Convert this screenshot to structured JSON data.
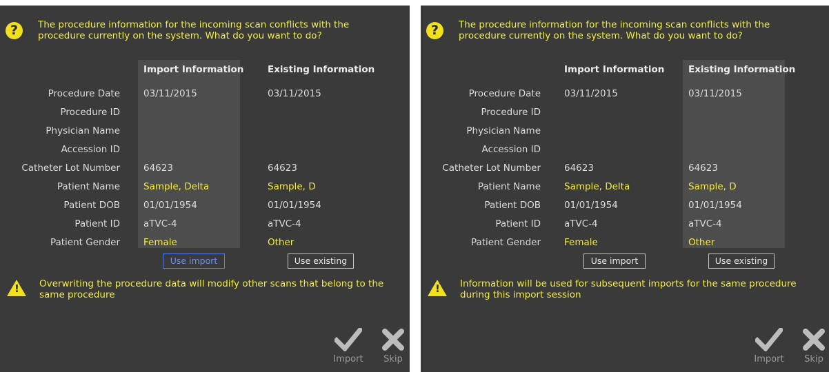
{
  "panels": [
    {
      "question": "The procedure information for the incoming scan conflicts with the procedure currently on the system.  What do you want to do?",
      "import_header": "Import Information",
      "existing_header": "Existing Information",
      "labels": [
        "Procedure Date",
        "Procedure ID",
        "Physician Name",
        "Accession ID",
        "Catheter Lot Number",
        "Patient Name",
        "Patient DOB",
        "Patient ID",
        "Patient Gender"
      ],
      "import_values": [
        "03/11/2015",
        "",
        "",
        "",
        "64623",
        "Sample, Delta",
        "01/01/1954",
        "aTVC-4",
        "Female"
      ],
      "existing_values": [
        "03/11/2015",
        "",
        "",
        "",
        "64623",
        "Sample, D",
        "01/01/1954",
        "aTVC-4",
        "Other"
      ],
      "use_import_label": "Use import",
      "use_existing_label": "Use existing",
      "selected": "import",
      "warning": "Overwriting the procedure data will modify other scans that belong to the same procedure",
      "import_action": "Import",
      "skip_action": "Skip"
    },
    {
      "question": "The procedure information for the incoming scan conflicts with the procedure currently on the system.  What do you want to do?",
      "import_header": "Import Information",
      "existing_header": "Existing Information",
      "labels": [
        "Procedure Date",
        "Procedure ID",
        "Physician Name",
        "Accession ID",
        "Catheter Lot Number",
        "Patient Name",
        "Patient DOB",
        "Patient ID",
        "Patient Gender"
      ],
      "import_values": [
        "03/11/2015",
        "",
        "",
        "",
        "64623",
        "Sample, Delta",
        "01/01/1954",
        "aTVC-4",
        "Female"
      ],
      "existing_values": [
        "03/11/2015",
        "",
        "",
        "",
        "64623",
        "Sample, D",
        "01/01/1954",
        "aTVC-4",
        "Other"
      ],
      "use_import_label": "Use import",
      "use_existing_label": "Use existing",
      "selected": "existing",
      "warning": "Information will be used for subsequent imports for the same procedure during this import session",
      "import_action": "Import",
      "skip_action": "Skip"
    }
  ],
  "colors": {
    "background": "#3a3a3a",
    "accent_text": "#f3ec3a",
    "highlight_column": "#4d4d4d",
    "selected_button": "#6f8ff0"
  },
  "icons": {
    "question": "question-circle-icon",
    "warning": "warning-triangle-icon",
    "import": "checkmark-icon",
    "skip": "x-icon"
  }
}
